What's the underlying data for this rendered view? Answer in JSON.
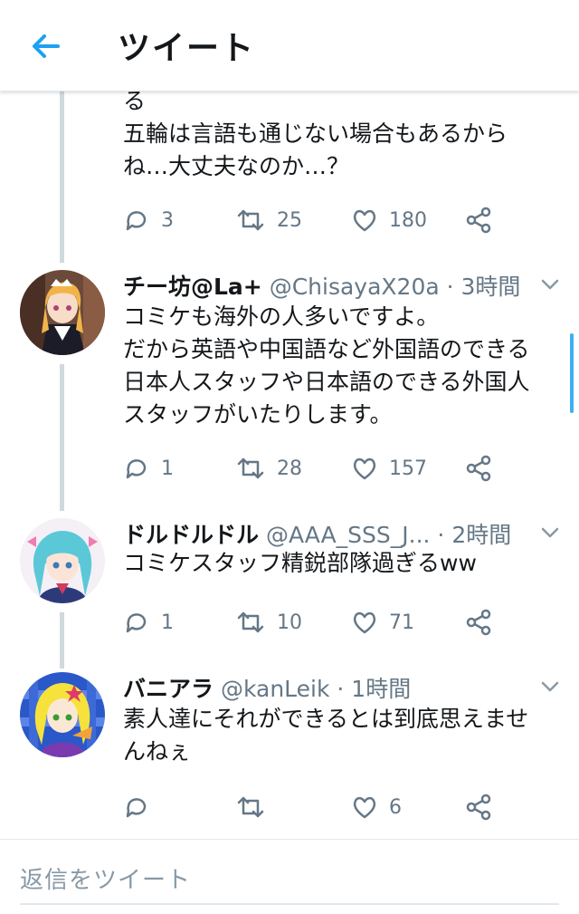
{
  "header": {
    "title": "ツイート",
    "back_icon": "arrow-left-icon",
    "accent_color": "#1da1f2"
  },
  "partial_tweet": {
    "text": "る\n五輪は言語も通じない場合もあるから\nね…大丈夫なのか…？",
    "actions": {
      "reply_count": "3",
      "retweet_count": "25",
      "like_count": "180"
    }
  },
  "tweets": [
    {
      "display_name": "チー坊@La+",
      "meta": "@ChisayaX20a · 3時間",
      "text": "コミケも海外の人多いですよ。\nだから英語や中国語など外国語のできる\n日本人スタッフや日本語のできる外国人\nスタッフがいたりします。",
      "reply_count": "1",
      "retweet_count": "28",
      "like_count": "157"
    },
    {
      "display_name": "ドルドルドル",
      "meta": "@AAA_SSS_J... · 2時間",
      "text": "コミケスタッフ精鋭部隊過ぎるww",
      "reply_count": "1",
      "retweet_count": "10",
      "like_count": "71"
    },
    {
      "display_name": "バニアラ",
      "meta": "@kanLeik · 1時間",
      "text": "素人達にそれができるとは到底思えませ\nんねぇ",
      "reply_count": "",
      "retweet_count": "",
      "like_count": "6"
    }
  ],
  "reply_box": {
    "placeholder": "返信をツイート"
  },
  "colors": {
    "text": "#14171a",
    "secondary": "#657786",
    "border": "#e1e8ed",
    "thread_line": "#cfd9de"
  }
}
